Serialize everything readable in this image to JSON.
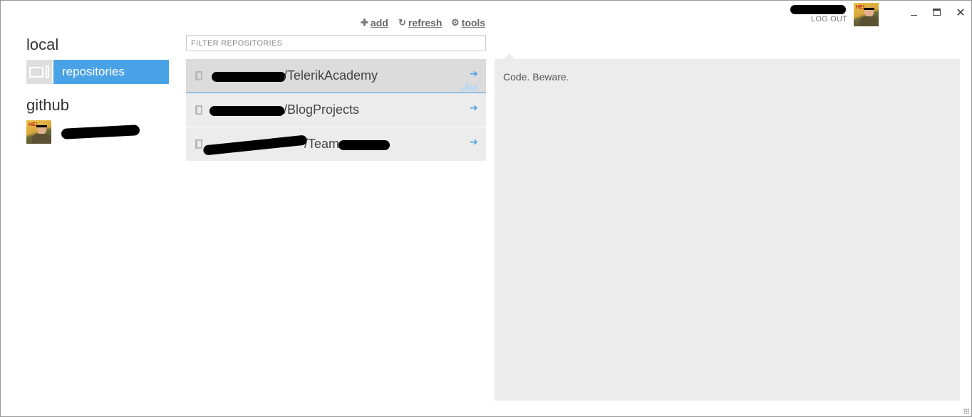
{
  "window": {
    "controls": {
      "minimize_icon": "minimize-icon",
      "maximize_icon": "maximize-icon",
      "close_icon": "close-icon",
      "close_glyph": "✕"
    }
  },
  "account": {
    "logout_label": "LOG OUT",
    "avatar_badge": "HE!"
  },
  "toolbar": {
    "add": {
      "icon": "plus-icon",
      "glyph": "✚",
      "label": "add"
    },
    "refresh": {
      "icon": "refresh-icon",
      "glyph": "↻",
      "label": "refresh"
    },
    "tools": {
      "icon": "gear-icon",
      "glyph": "⚙",
      "label": "tools"
    }
  },
  "sidebar": {
    "local_heading": "local",
    "local_items": [
      {
        "icon": "computer-icon",
        "label": "repositories",
        "selected": true
      }
    ],
    "github_heading": "github",
    "github_avatar_badge": "HE!"
  },
  "filter": {
    "placeholder": "FILTER REPOSITORIES",
    "value": ""
  },
  "repositories": [
    {
      "name": "/TelerikAcademy",
      "selected": true,
      "pinned": true,
      "icon": "book-icon",
      "arrow": "➔"
    },
    {
      "name": "/BlogProjects",
      "selected": false,
      "pinned": false,
      "icon": "book-icon",
      "arrow": "➔"
    },
    {
      "name": "/Team",
      "selected": false,
      "pinned": false,
      "icon": "book-icon",
      "arrow": "➔"
    }
  ],
  "details": {
    "description": "Code. Beware."
  },
  "colors": {
    "accent": "#4aa2e6",
    "panel": "#ececec",
    "selected_row": "#dcdcdc"
  }
}
